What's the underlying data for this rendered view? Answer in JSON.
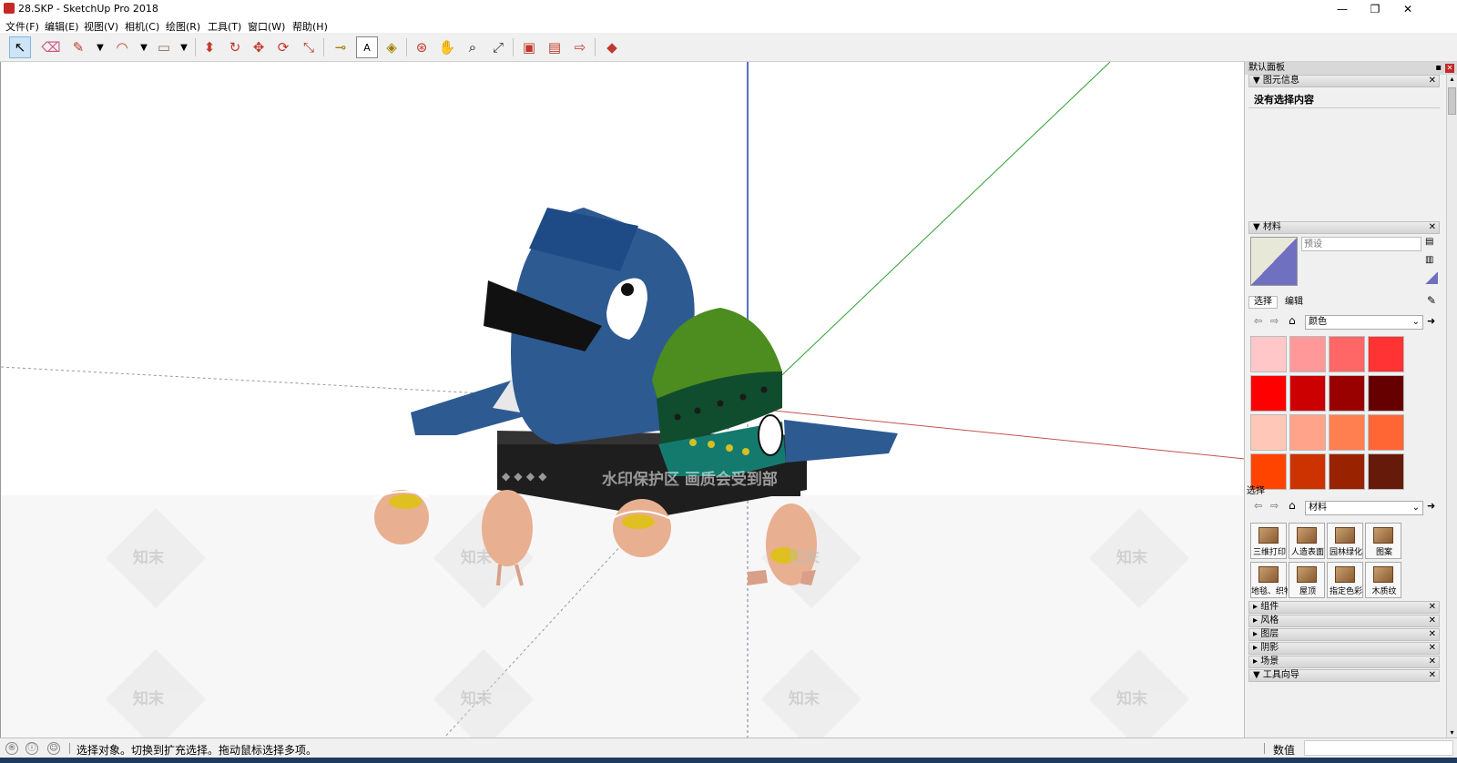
{
  "window": {
    "title": "28.SKP - SketchUp Pro 2018",
    "minimize": "—",
    "restore": "❐",
    "close": "✕"
  },
  "menu": [
    "文件(F)",
    "编辑(E)",
    "视图(V)",
    "相机(C)",
    "绘图(R)",
    "工具(T)",
    "窗口(W)",
    "帮助(H)"
  ],
  "tools": [
    {
      "name": "select-tool",
      "icon": "↖"
    },
    {
      "name": "eraser-tool",
      "icon": "⌫"
    },
    {
      "name": "pencil-tool",
      "icon": "✎"
    },
    {
      "name": "arc-tool",
      "icon": "◠"
    },
    {
      "name": "rectangle-tool",
      "icon": "▭"
    },
    {
      "name": "push-pull-tool",
      "icon": "⬍"
    },
    {
      "name": "follow-me-tool",
      "icon": "↻"
    },
    {
      "name": "move-tool",
      "icon": "✥"
    },
    {
      "name": "rotate-tool",
      "icon": "⟳"
    },
    {
      "name": "scale-tool",
      "icon": "⤡"
    },
    {
      "name": "tape-measure-tool",
      "icon": "📏"
    },
    {
      "name": "text-tool",
      "icon": "A"
    },
    {
      "name": "paint-bucket-tool",
      "icon": "🪣"
    },
    {
      "name": "orbit-tool",
      "icon": "⊛"
    },
    {
      "name": "pan-tool",
      "icon": "✋"
    },
    {
      "name": "zoom-tool",
      "icon": "🔍"
    },
    {
      "name": "zoom-extents-tool",
      "icon": "⤢"
    },
    {
      "name": "3d-warehouse-tool",
      "icon": "▣"
    },
    {
      "name": "extension-warehouse-tool",
      "icon": "▤"
    },
    {
      "name": "send-to-layout-tool",
      "icon": "⇨"
    },
    {
      "name": "ruby-tool",
      "icon": "◆"
    }
  ],
  "viewport": {
    "watermark": "水印保护区  画质会受到部",
    "watermark2": "知末",
    "diamond_marks": "◆ ◆ ◆ ◆"
  },
  "panel": {
    "tray_title": "默认面板",
    "entity_info": {
      "title": "图元信息",
      "text": "没有选择内容"
    },
    "materials": {
      "title": "材料",
      "name_placeholder": "预设",
      "tab_select": "选择",
      "tab_edit": "编辑",
      "library": "颜色",
      "secondary_label": "选择",
      "secondary_library": "材料",
      "colors": [
        "#ffc7c7",
        "#ff9999",
        "#ff6666",
        "#ff3333",
        "#ff0000",
        "#cc0000",
        "#990000",
        "#660000",
        "#ffc7b7",
        "#ffa38a",
        "#ff7f50",
        "#ff6633",
        "#ff4400",
        "#cc3300",
        "#992200",
        "#661a0a"
      ],
      "categories": [
        "三维打印",
        "人造表面",
        "园林绿化",
        "图案",
        "地毯、织物",
        "屋顶",
        "指定色彩",
        "木质纹"
      ]
    },
    "collapsed": [
      "组件",
      "风格",
      "图层",
      "阴影",
      "场景",
      "工具向导"
    ]
  },
  "status": {
    "message": "选择对象。切换到扩充选择。拖动鼠标选择多项。",
    "measure_label": "数值",
    "measure_value": ""
  }
}
